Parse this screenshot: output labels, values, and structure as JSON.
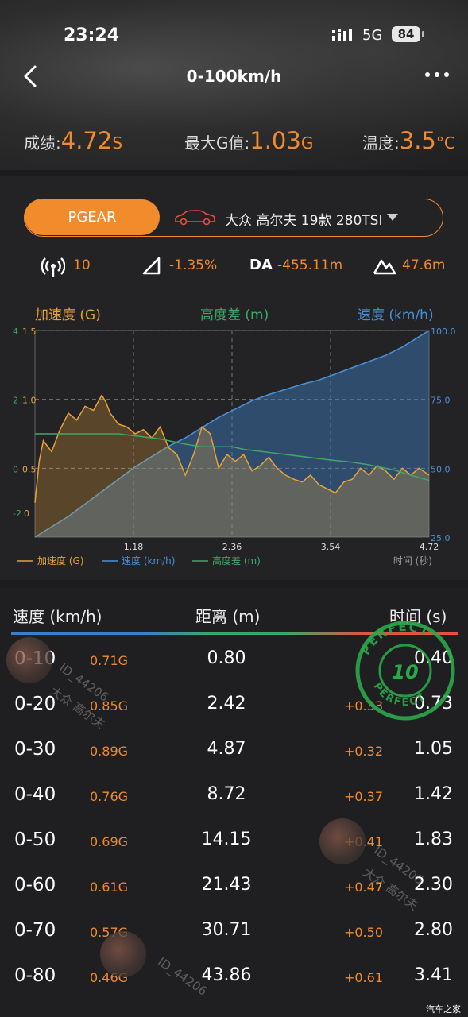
{
  "status": {
    "time": "23:24",
    "network": "5G",
    "battery": "84"
  },
  "nav": {
    "title": "0-100km/h"
  },
  "results": {
    "score_label": "成绩:",
    "score_value": "4.72",
    "score_unit": "S",
    "maxg_label": "最大G值:",
    "maxg_value": "1.03",
    "maxg_unit": "G",
    "temp_label": "温度:",
    "temp_value": "3.5",
    "temp_unit": "°C"
  },
  "car": {
    "pgear_label": "PGEAR",
    "model": "大众 高尔夫 19款 280TSI"
  },
  "stats": {
    "satellites": "10",
    "slope": "-1.35%",
    "da_label": "DA",
    "da_value": "-455.11m",
    "altitude": "47.6m"
  },
  "colors": {
    "accent": "#f08a2e",
    "speed": "#3d7fc5",
    "altitude": "#3fa66a",
    "time": "#e5533d"
  },
  "chart_data": {
    "type": "line",
    "titles": {
      "accel": "加速度 (G)",
      "altitude": "高度差 (m)",
      "speed": "速度 (km/h)"
    },
    "left_ticks_accel": [
      "1.5",
      "1.0",
      "0.5",
      "0"
    ],
    "left_ticks_alt": [
      "4",
      "2",
      "0",
      "-2"
    ],
    "right_ticks": [
      "100.0",
      "75.0",
      "50.0",
      "25.0"
    ],
    "x_ticks": [
      "1.18",
      "2.36",
      "3.54",
      "4.72"
    ],
    "x_label": "时间 (秒)",
    "xlim": [
      0,
      4.72
    ],
    "accel_ylim": [
      0,
      1.5
    ],
    "speed_ylim": [
      0,
      100
    ],
    "alt_ylim": [
      -4,
      4
    ],
    "legend": [
      "加速度 (G)",
      "速度 (km/h)",
      "高度差 (m)"
    ],
    "series": [
      {
        "name": "速度 (km/h)",
        "x": [
          0,
          0.2,
          0.4,
          0.6,
          0.8,
          1.0,
          1.2,
          1.4,
          1.6,
          1.8,
          2.0,
          2.2,
          2.4,
          2.6,
          2.8,
          3.0,
          3.2,
          3.4,
          3.6,
          3.8,
          4.0,
          4.2,
          4.4,
          4.6,
          4.72
        ],
        "values": [
          0,
          5,
          10,
          16,
          22,
          28,
          34,
          39,
          44,
          48,
          53,
          58,
          62,
          66,
          69,
          71.5,
          74,
          76,
          79,
          82,
          85,
          88,
          92,
          97,
          100
        ]
      },
      {
        "name": "加速度 (G)",
        "x": [
          0,
          0.05,
          0.1,
          0.2,
          0.3,
          0.4,
          0.5,
          0.6,
          0.7,
          0.8,
          0.85,
          0.9,
          1.0,
          1.1,
          1.2,
          1.3,
          1.4,
          1.5,
          1.6,
          1.7,
          1.8,
          1.9,
          2.0,
          2.1,
          2.2,
          2.3,
          2.4,
          2.5,
          2.6,
          2.7,
          2.8,
          2.9,
          3.0,
          3.1,
          3.2,
          3.3,
          3.4,
          3.5,
          3.6,
          3.7,
          3.8,
          3.9,
          4.0,
          4.1,
          4.2,
          4.3,
          4.4,
          4.5,
          4.6,
          4.72
        ],
        "values": [
          0.25,
          0.55,
          0.7,
          0.62,
          0.78,
          0.9,
          0.85,
          0.95,
          0.92,
          1.03,
          0.98,
          0.9,
          0.82,
          0.8,
          0.75,
          0.78,
          0.72,
          0.8,
          0.65,
          0.6,
          0.45,
          0.6,
          0.8,
          0.75,
          0.5,
          0.6,
          0.55,
          0.6,
          0.48,
          0.52,
          0.58,
          0.5,
          0.45,
          0.42,
          0.4,
          0.45,
          0.38,
          0.35,
          0.32,
          0.4,
          0.42,
          0.5,
          0.45,
          0.52,
          0.48,
          0.42,
          0.5,
          0.45,
          0.5,
          0.45
        ]
      },
      {
        "name": "高度差 (m)",
        "x": [
          0,
          0.5,
          1.0,
          1.5,
          1.8,
          2.0,
          2.36,
          2.5,
          3.0,
          3.5,
          3.8,
          4.0,
          4.3,
          4.5,
          4.72
        ],
        "values": [
          0,
          0,
          0,
          -0.2,
          -0.4,
          -0.5,
          -0.5,
          -0.6,
          -0.8,
          -1.0,
          -1.1,
          -1.2,
          -1.4,
          -1.6,
          -1.8
        ]
      }
    ]
  },
  "table": {
    "headers": {
      "speed": "速度 (km/h)",
      "distance": "距离 (m)",
      "time": "时间 (s)"
    },
    "rows": [
      {
        "range": "0-10",
        "g": "0.71G",
        "distance": "0.80",
        "delta": "",
        "time": "0.40"
      },
      {
        "range": "0-20",
        "g": "0.85G",
        "distance": "2.42",
        "delta": "+0.33",
        "time": "0.73"
      },
      {
        "range": "0-30",
        "g": "0.89G",
        "distance": "4.87",
        "delta": "+0.32",
        "time": "1.05"
      },
      {
        "range": "0-40",
        "g": "0.76G",
        "distance": "8.72",
        "delta": "+0.37",
        "time": "1.42"
      },
      {
        "range": "0-50",
        "g": "0.69G",
        "distance": "14.15",
        "delta": "+0.41",
        "time": "1.83"
      },
      {
        "range": "0-60",
        "g": "0.61G",
        "distance": "21.43",
        "delta": "+0.47",
        "time": "2.30"
      },
      {
        "range": "0-70",
        "g": "0.57G",
        "distance": "30.71",
        "delta": "+0.50",
        "time": "2.80"
      },
      {
        "range": "0-80",
        "g": "0.46G",
        "distance": "43.86",
        "delta": "+0.61",
        "time": "3.41"
      }
    ]
  },
  "stamp": {
    "text": "PERFECT",
    "number": "10"
  },
  "watermarks": {
    "id": "ID_44206",
    "car": "大众 高尔夫"
  },
  "site_label": "汽车之家"
}
